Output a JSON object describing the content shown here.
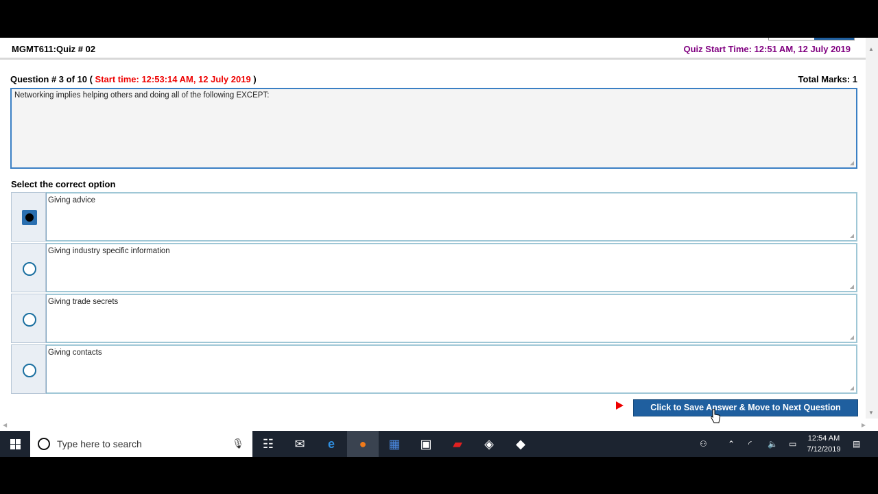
{
  "quiz": {
    "title": "MGMT611:Quiz # 02",
    "start_time_label": "Quiz Start Time: 12:51 AM, 12 July 2019"
  },
  "question": {
    "header_prefix": "Question # 3 of 10 (",
    "start_time": "Start time: 12:53:14 AM, 12 July 2019",
    "header_suffix": ")",
    "total_marks": "Total Marks: 1",
    "text": "Networking implies helping others and doing all of the following EXCEPT:"
  },
  "options_label": "Select the correct option",
  "options": [
    {
      "label": "Giving advice",
      "selected": true
    },
    {
      "label": "Giving industry specific information",
      "selected": false
    },
    {
      "label": "Giving trade secrets",
      "selected": false
    },
    {
      "label": "Giving contacts",
      "selected": false
    }
  ],
  "save_button": "Click to Save Answer & Move to Next Question",
  "taskbar": {
    "search_placeholder": "Type here to search",
    "apps": [
      "task-view-icon",
      "mail-icon",
      "edge-icon",
      "firefox-icon",
      "word-icon",
      "store-icon",
      "acrobat-icon",
      "app-icon",
      "app2-icon"
    ],
    "clock_time": "12:54 AM",
    "clock_date": "7/12/2019"
  },
  "colors": {
    "accent": "#1f5f9f",
    "start_time": "#800080",
    "question_start": "#e00000"
  }
}
